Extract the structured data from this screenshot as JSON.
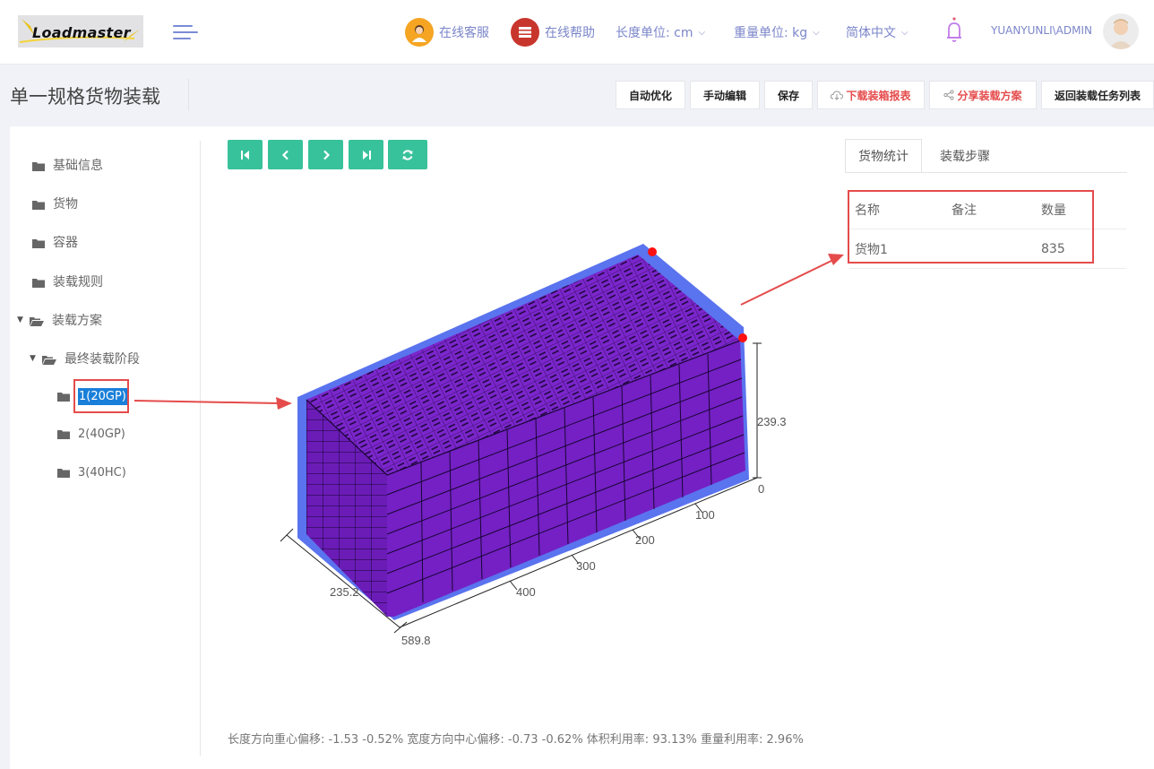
{
  "header": {
    "logo_text": "Loadmaster",
    "online_service": "在线客服",
    "online_help": "在线帮助",
    "length_unit": "长度单位: cm",
    "weight_unit": "重量单位: kg",
    "language": "简体中文",
    "username": "YUANYUNLI\\ADMIN"
  },
  "page": {
    "title": "单一规格货物装载"
  },
  "toolbar": {
    "auto_optimize": "自动优化",
    "manual_edit": "手动编辑",
    "save": "保存",
    "download_report": "下载装箱报表",
    "share_plan": "分享装载方案",
    "back_to_list": "返回装载任务列表"
  },
  "tree": {
    "basic_info": "基础信息",
    "cargo": "货物",
    "container": "容器",
    "loading_rules": "装载规则",
    "loading_plan": "装载方案",
    "final_stage": "最终装载阶段",
    "containers": [
      "1(20GP)",
      "2(40GP)",
      "3(40HC)"
    ]
  },
  "tabs": {
    "stats": "货物统计",
    "steps": "装载步骤"
  },
  "stats_table": {
    "headers": [
      "名称",
      "备注",
      "数量"
    ],
    "rows": [
      {
        "name": "货物1",
        "note": "",
        "qty": "835"
      }
    ]
  },
  "viewer": {
    "height_label": "239.3",
    "width_label": "235.2",
    "length_label": "589.8",
    "ticks": [
      "0",
      "100",
      "200",
      "300",
      "400"
    ]
  },
  "footer": {
    "stats": "长度方向重心偏移: -1.53 -0.52% 宽度方向中心偏移: -0.73 -0.62% 体积利用率: 93.13% 重量利用率: 2.96%"
  },
  "colors": {
    "accent_green": "#38c29b",
    "brand_blue": "#7b86c9",
    "cargo_purple": "#7420c4",
    "container_blue": "#5a73ee",
    "highlight_red": "#e54b4b"
  },
  "icons": [
    "agent-avatar-icon",
    "help-book-icon",
    "bell-icon",
    "folder-icon",
    "first-page-icon",
    "prev-icon",
    "next-icon",
    "last-page-icon",
    "refresh-icon",
    "cloud-download-icon",
    "share-icon"
  ]
}
